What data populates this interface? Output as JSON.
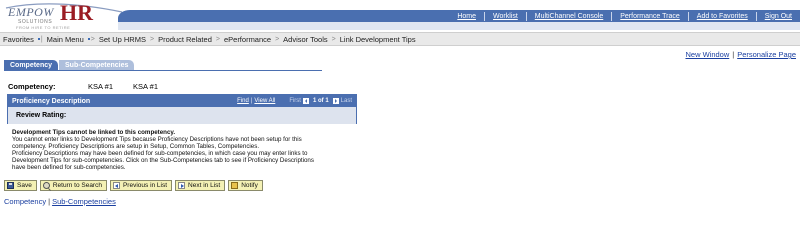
{
  "logo": {
    "wordmark": "EMPOW",
    "hr": "HR",
    "subline": "SOLUTIONS",
    "tagline": "FROM HIRE TO RETIRE"
  },
  "header_links": [
    "Home",
    "Worklist",
    "MultiChannel Console",
    "Performance Trace",
    "Add to Favorites",
    "Sign Out"
  ],
  "breadcrumb": [
    "Favorites",
    "Main Menu",
    "Set Up HRMS",
    "Product Related",
    "ePerformance",
    "Advisor Tools",
    "Link Development Tips"
  ],
  "page_links": {
    "new_window": "New Window",
    "personalize": "Personalize Page"
  },
  "tabs": [
    "Competency",
    "Sub-Competencies"
  ],
  "competency": {
    "label": "Competency:",
    "value1": "KSA #1",
    "value2": "KSA #1"
  },
  "proficiency": {
    "title": "Proficiency Description",
    "find": "Find",
    "view_all": "View All",
    "first": "First",
    "count": "1 of 1",
    "last": "Last",
    "review_rating_label": "Review Rating:"
  },
  "message": {
    "title": "Development Tips cannot be linked to this competency.",
    "lines": [
      "You cannot enter links to Development Tips because Proficiency Descriptions have not been setup for this",
      "competency. Proficiency Descriptions are setup in Setup, Common Tables, Competencies.",
      "Proficiency Descriptions may have been defined for sub-competencies, in which case you may enter links to",
      "Development Tips for sub-competencies. Click on the Sub-Competencies tab to see if Proficiency Descriptions",
      "have been defined for sub-competencies."
    ]
  },
  "toolbar": {
    "save": "Save",
    "return_to_search": "Return to Search",
    "previous_in_list": "Previous in List",
    "next_in_list": "Next in List",
    "notify": "Notify"
  },
  "bottom_links": [
    "Competency",
    "Sub-Competencies"
  ],
  "colors": {
    "accent": "#4b6fb0",
    "button": "#f4f1b5",
    "link": "#1a3fa0"
  }
}
